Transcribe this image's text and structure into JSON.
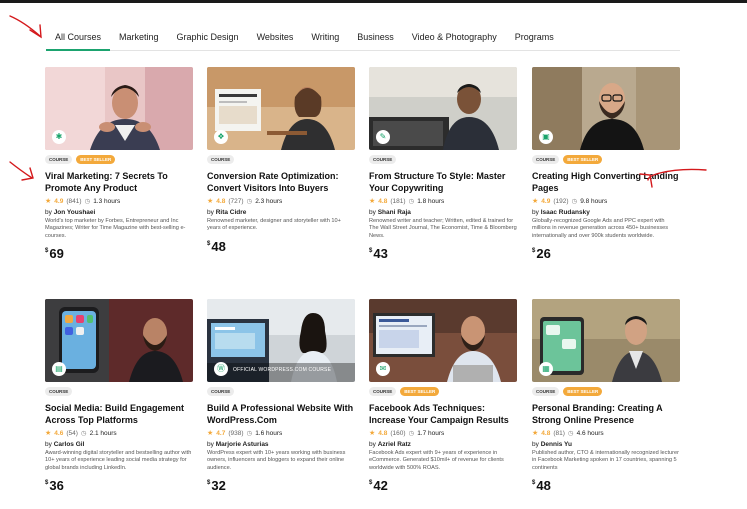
{
  "tabs": [
    {
      "label": "All Courses",
      "active": true
    },
    {
      "label": "Marketing",
      "active": false
    },
    {
      "label": "Graphic Design",
      "active": false
    },
    {
      "label": "Websites",
      "active": false
    },
    {
      "label": "Writing",
      "active": false
    },
    {
      "label": "Business",
      "active": false
    },
    {
      "label": "Video & Photography",
      "active": false
    },
    {
      "label": "Programs",
      "active": false
    }
  ],
  "badge_labels": {
    "course": "COURSE",
    "best_seller": "BEST SELLER"
  },
  "currency": "$",
  "courses": [
    {
      "title": "Viral Marketing: 7 Secrets To Promote Any Product",
      "rating": "4.9",
      "reviews": "(841)",
      "hours": "1.3 hours",
      "author_prefix": "by",
      "author": "Jon Youshaei",
      "bio": "World's top marketer by Forbes, Entrepreneur and Inc Magazines; Writer for Time Magazine with best-selling e-courses.",
      "price": "69",
      "best_seller": true
    },
    {
      "title": "Conversion Rate Optimization: Convert Visitors Into Buyers",
      "rating": "4.8",
      "reviews": "(727)",
      "hours": "2.3 hours",
      "author_prefix": "by",
      "author": "Rita Cidre",
      "bio": "Renowned marketer, designer and storyteller with 10+ years of experience.",
      "price": "48",
      "best_seller": false
    },
    {
      "title": "From Structure To Style: Master Your Copywriting",
      "rating": "4.8",
      "reviews": "(181)",
      "hours": "1.8 hours",
      "author_prefix": "by",
      "author": "Shani Raja",
      "bio": "Renowned writer and teacher; Written, edited & trained for The Wall Street Journal, The Economist, Time & Bloomberg News.",
      "price": "43",
      "best_seller": false
    },
    {
      "title": "Creating High Converting Landing Pages",
      "rating": "4.9",
      "reviews": "(192)",
      "hours": "9.8 hours",
      "author_prefix": "by",
      "author": "Isaac Rudansky",
      "bio": "Globally-recognized Google Ads and PPC expert with millions in revenue generation across 450+ businesses internationally and over 900k students worldwide.",
      "price": "26",
      "best_seller": true
    },
    {
      "title": "Social Media: Build Engagement Across Top Platforms",
      "rating": "4.6",
      "reviews": "(54)",
      "hours": "2.1 hours",
      "author_prefix": "by",
      "author": "Carlos Gil",
      "bio": "Award-winning digital storyteller and bestselling author with 10+ years of experience leading social media strategy for global brands including LinkedIn.",
      "price": "36",
      "best_seller": false
    },
    {
      "title": "Build A Professional Website With WordPress.Com",
      "rating": "4.7",
      "reviews": "(938)",
      "hours": "1.6 hours",
      "author_prefix": "by",
      "author": "Marjorie Asturias",
      "bio": "WordPress expert with 10+ years working with business owners, influencers and bloggers to expand their online audience.",
      "price": "32",
      "best_seller": false,
      "overlay": "OFFICIAL WORDPRESS.COM COURSE"
    },
    {
      "title": "Facebook Ads Techniques: Increase Your Campaign Results",
      "rating": "4.8",
      "reviews": "(160)",
      "hours": "1.7 hours",
      "author_prefix": "by",
      "author": "Azriel Ratz",
      "bio": "Facebook Ads expert with 9+ years of experience in eCommerce. Generated $10mil+ of revenue for clients worldwide with 500% ROAS.",
      "price": "42",
      "best_seller": true
    },
    {
      "title": "Personal Branding: Creating A Strong Online Presence",
      "rating": "4.8",
      "reviews": "(81)",
      "hours": "4.6 hours",
      "author_prefix": "by",
      "author": "Dennis Yu",
      "bio": "Published author, CTO & internationally recognized lecturer in Facebook Marketing spoken in 17 countries, spanning 5 continents",
      "price": "48",
      "best_seller": true
    }
  ],
  "icons": [
    "star-icon",
    "clock-icon",
    "category-icon"
  ],
  "colors": {
    "accent": "#1ba36f",
    "best_seller": "#f3a93b",
    "star": "#f3a93b",
    "annotation": "#d4191c"
  }
}
